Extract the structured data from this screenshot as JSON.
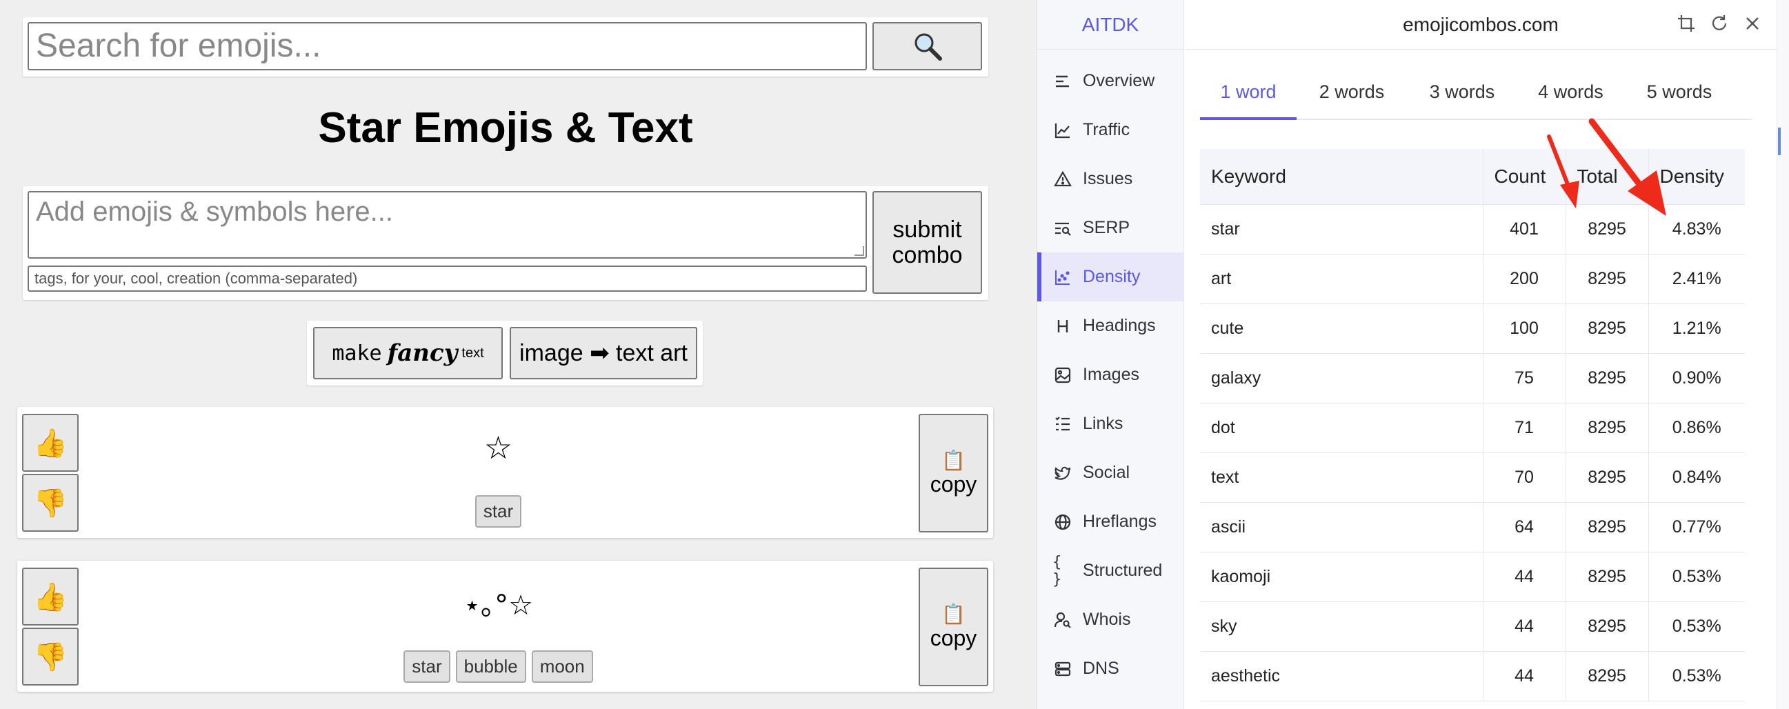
{
  "search": {
    "placeholder": "Search for emojis..."
  },
  "page_title": "Star Emojis & Text",
  "combo": {
    "emoji_placeholder": "Add emojis & symbols here...",
    "tags_placeholder": "tags, for your, cool, creation (comma-separated)",
    "submit_line1": "submit",
    "submit_line2": "combo"
  },
  "tools": {
    "fancy_make": "make",
    "fancy_word": "fancy",
    "fancy_text": "text",
    "image_to_text": "image ➡ text art"
  },
  "cards": [
    {
      "combo": "☆",
      "tags": [
        "star"
      ],
      "copy_label": "copy",
      "copy_icon": "📋",
      "up_icon": "👍",
      "down_icon": "👎"
    },
    {
      "combo": "⋆｡°☆",
      "tags": [
        "star",
        "bubble",
        "moon"
      ],
      "copy_label": "copy",
      "copy_icon": "📋",
      "up_icon": "👍",
      "down_icon": "👎"
    }
  ],
  "extension": {
    "brand": "AITDK",
    "domain": "emojicombos.com",
    "header_icons": [
      "crop-icon",
      "refresh-icon",
      "close-icon"
    ],
    "nav": [
      {
        "label": "Overview",
        "icon": "overview-icon"
      },
      {
        "label": "Traffic",
        "icon": "traffic-icon"
      },
      {
        "label": "Issues",
        "icon": "warning-icon"
      },
      {
        "label": "SERP",
        "icon": "serp-icon"
      },
      {
        "label": "Density",
        "icon": "density-icon",
        "active": true
      },
      {
        "label": "Headings",
        "icon": "heading-icon"
      },
      {
        "label": "Images",
        "icon": "image-icon"
      },
      {
        "label": "Links",
        "icon": "links-icon"
      },
      {
        "label": "Social",
        "icon": "twitter-icon"
      },
      {
        "label": "Hreflangs",
        "icon": "globe-icon"
      },
      {
        "label": "Structured",
        "icon": "braces-icon"
      },
      {
        "label": "Whois",
        "icon": "user-search-icon"
      },
      {
        "label": "DNS",
        "icon": "server-icon"
      }
    ],
    "tabs": [
      {
        "label": "1 word",
        "active": true
      },
      {
        "label": "2 words"
      },
      {
        "label": "3 words"
      },
      {
        "label": "4 words"
      },
      {
        "label": "5 words"
      }
    ],
    "table": {
      "headers": [
        "Keyword",
        "Count",
        "Total",
        "Density"
      ],
      "rows": [
        [
          "star",
          "401",
          "8295",
          "4.83%"
        ],
        [
          "art",
          "200",
          "8295",
          "2.41%"
        ],
        [
          "cute",
          "100",
          "8295",
          "1.21%"
        ],
        [
          "galaxy",
          "75",
          "8295",
          "0.90%"
        ],
        [
          "dot",
          "71",
          "8295",
          "0.86%"
        ],
        [
          "text",
          "70",
          "8295",
          "0.84%"
        ],
        [
          "ascii",
          "64",
          "8295",
          "0.77%"
        ],
        [
          "kaomoji",
          "44",
          "8295",
          "0.53%"
        ],
        [
          "sky",
          "44",
          "8295",
          "0.53%"
        ],
        [
          "aesthetic",
          "44",
          "8295",
          "0.53%"
        ]
      ]
    },
    "accent_color": "#5b57e8",
    "annotation_color": "#ee2a1b"
  }
}
